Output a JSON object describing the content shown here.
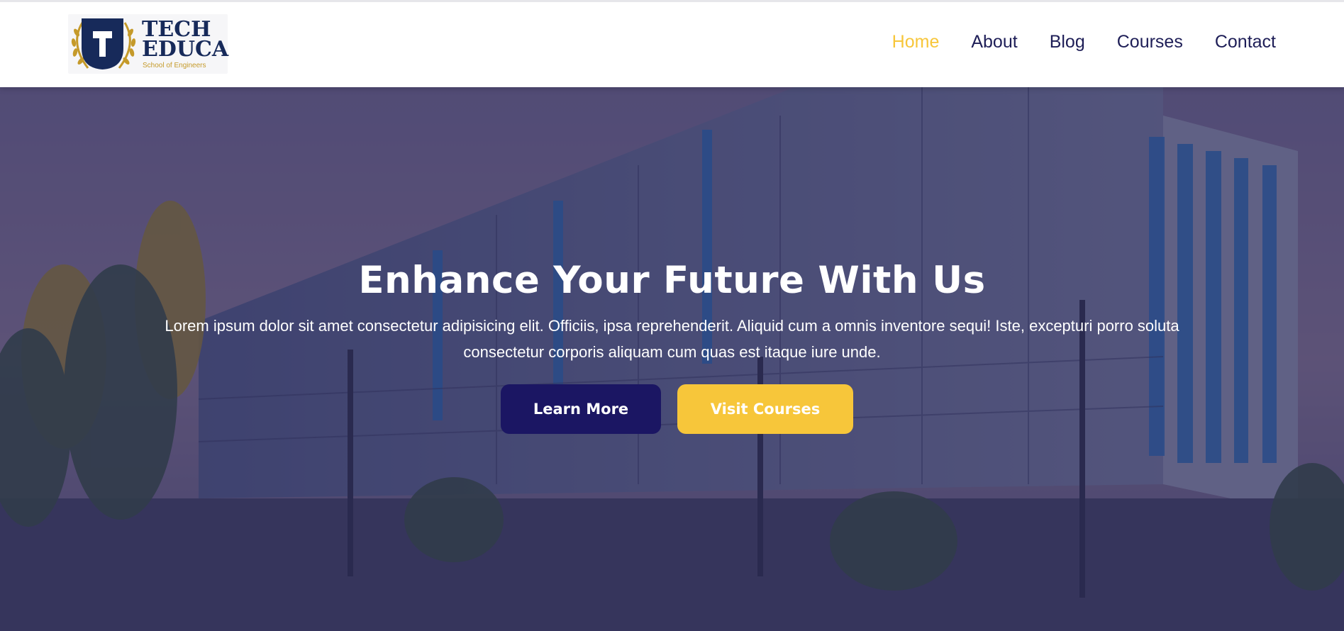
{
  "brand": {
    "logo_letter": "T",
    "line1": "TECH",
    "line2": "EDUCA",
    "tagline": "School of Engineers"
  },
  "nav": {
    "items": [
      {
        "label": "Home",
        "active": true
      },
      {
        "label": "About",
        "active": false
      },
      {
        "label": "Blog",
        "active": false
      },
      {
        "label": "Courses",
        "active": false
      },
      {
        "label": "Contact",
        "active": false
      }
    ]
  },
  "hero": {
    "title": "Enhance Your Future With Us",
    "description": "Lorem ipsum dolor sit amet consectetur adipisicing elit. Officiis, ipsa reprehenderit. Aliquid cum a omnis inventore sequi! Iste, excepturi porro soluta consectetur corporis aliquam cum quas est itaque iure unde.",
    "primary_button": "Learn More",
    "secondary_button": "Visit Courses"
  },
  "colors": {
    "accent_yellow": "#f7c63a",
    "navy": "#1b1663",
    "nav_text": "#1e1e57",
    "logo_navy": "#172a5a",
    "logo_gold": "#c59a2a"
  }
}
